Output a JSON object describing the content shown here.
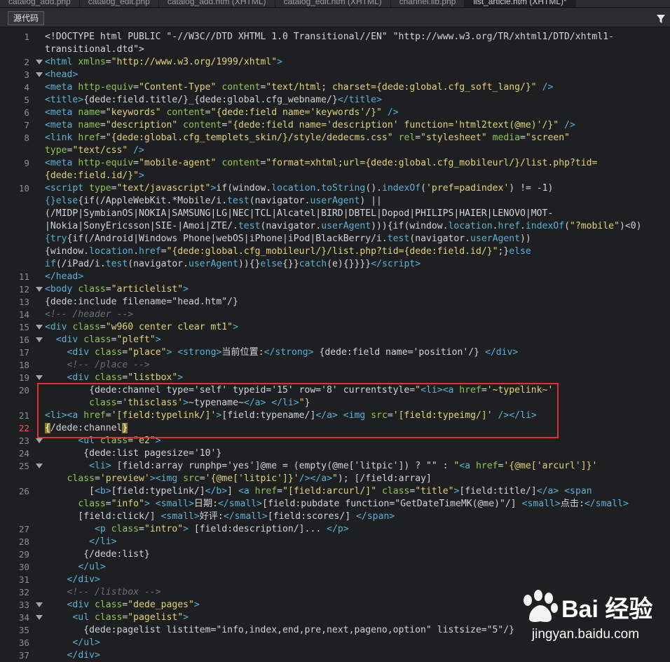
{
  "tabs": [
    {
      "label": "catalog_add.php"
    },
    {
      "label": "catalog_edit.php"
    },
    {
      "label": "catalog_add.htm (XHTML)"
    },
    {
      "label": "catalog_edit.htm (XHTML)"
    },
    {
      "label": "channel.lib.php"
    },
    {
      "label": "list_article.htm (XHTML)*"
    }
  ],
  "toolbar": {
    "source_label": "源代码",
    "filter_icon": "funnel-icon"
  },
  "watermark": {
    "logo_text": "Bai 经验",
    "url": "jingyan.baidu.com"
  },
  "colors": {
    "highlight_border": "#e0312e",
    "current_line": "#ff5050"
  },
  "lines": [
    {
      "num": "1",
      "fold": false,
      "html": "&lt;!DOCTYPE html PUBLIC &quot;-//W3C//DTD XHTML 1.0 Transitional//EN&quot; &quot;http://www.w3.org/TR/xhtml1/DTD/xhtml1-"
    },
    {
      "num": "",
      "fold": false,
      "html": "transitional.dtd&quot;&gt;"
    },
    {
      "num": "2",
      "fold": true,
      "html": "<span class=t>&lt;html</span> <span class=a>xmlns</span>=<span class=s>&quot;http://www.w3.org/1999/xhtml&quot;</span><span class=t>&gt;</span>"
    },
    {
      "num": "3",
      "fold": true,
      "html": "<span class=t>&lt;head&gt;</span>"
    },
    {
      "num": "4",
      "fold": false,
      "html": "<span class=t>&lt;meta</span> <span class=a>http-equiv</span>=<span class=s>&quot;Content-Type&quot;</span> <span class=a>content</span>=<span class=s>&quot;text/html; charset={dede:global.cfg_soft_lang/}&quot;</span> <span class=t>/&gt;</span>"
    },
    {
      "num": "5",
      "fold": false,
      "html": "<span class=t>&lt;title&gt;</span>{dede:field.title/}_{dede:global.cfg_webname/}<span class=t>&lt;/title&gt;</span>"
    },
    {
      "num": "6",
      "fold": false,
      "html": "<span class=t>&lt;meta</span> <span class=a>name</span>=<span class=s>&quot;keywords&quot;</span> <span class=a>content</span>=<span class=s>&quot;{dede:field name='keywords'/}&quot;</span> <span class=t>/&gt;</span>"
    },
    {
      "num": "7",
      "fold": false,
      "html": "<span class=t>&lt;meta</span> <span class=a>name</span>=<span class=s>&quot;description&quot;</span> <span class=a>content</span>=<span class=s>&quot;{dede:field name='description' function='html2text(@me)'/}&quot;</span> <span class=t>/&gt;</span>"
    },
    {
      "num": "8",
      "fold": false,
      "html": "<span class=t>&lt;link</span> <span class=a>href</span>=<span class=s>&quot;{dede:global.cfg_templets_skin/}/style/dedecms.css&quot;</span> <span class=a>rel</span>=<span class=s>&quot;stylesheet&quot;</span> <span class=a>media</span>=<span class=s>&quot;screen&quot;</span>"
    },
    {
      "num": "",
      "fold": false,
      "html": "<span class=a>type</span>=<span class=s>&quot;text/css&quot;</span> <span class=t>/&gt;</span>"
    },
    {
      "num": "9",
      "fold": false,
      "html": "<span class=t>&lt;meta</span> <span class=a>http-equiv</span>=<span class=s>&quot;mobile-agent&quot;</span> <span class=a>content</span>=<span class=s>&quot;format=xhtml;url={dede:global.cfg_mobileurl/}/list.php?tid=</span>"
    },
    {
      "num": "",
      "fold": false,
      "html": "<span class=s>{dede:field.id/}&quot;</span><span class=t>&gt;</span>"
    },
    {
      "num": "10",
      "fold": false,
      "html": "<span class=t>&lt;script</span> <span class=a>type</span>=<span class=s>&quot;text/javascript&quot;</span><span class=t>&gt;</span>if(window.<span class=kw>location</span>.<span class=kw>toString</span>().<span class=kw>indexOf</span>(<span class=s>'pref=padindex'</span>) != -1)"
    },
    {
      "num": "",
      "fold": false,
      "html": "<span class=kw>{}else</span>{if(/AppleWebKit.*Mobile/i.<span class=kw>test</span>(navigator.<span class=kw>userAgent</span>) ||"
    },
    {
      "num": "",
      "fold": false,
      "html": "(/MIDP|SymbianOS|NOKIA|SAMSUNG|LG|NEC|TCL|Alcatel|BIRD|DBTEL|Dopod|PHILIPS|HAIER|LENOVO|MOT-"
    },
    {
      "num": "",
      "fold": false,
      "html": "|Nokia|SonyEricsson|SIE-|Amoi|ZTE/.<span class=kw>test</span>(navigator.<span class=kw>userAgent</span>))){if(window.<span class=kw>location</span>.<span class=kw>href</span>.<span class=kw>indexOf</span>(<span class=s>&quot;?mobile&quot;</span>)&lt;0)"
    },
    {
      "num": "",
      "fold": false,
      "html": "<span class=kw>{try</span>{if(/Android|Windows Phone|webOS|iPhone|iPod|BlackBerry/i.<span class=kw>test</span>(navigator.<span class=kw>userAgent</span>))"
    },
    {
      "num": "",
      "fold": false,
      "html": "{window.<span class=kw>location</span>.<span class=kw>href</span>=<span class=s>&quot;{dede:global.cfg_mobileurl/}/list.php?tid={dede:field.id/}&quot;</span>;}<span class=kw>else</span>"
    },
    {
      "num": "",
      "fold": false,
      "html": "<span class=kw>if</span>(/iPad/i.<span class=kw>test</span>(navigator.<span class=kw>userAgent</span>)){}<span class=kw>else</span>{}}<span class=kw>catch</span>(e){}}}}<span class=t>&lt;/script&gt;</span>"
    },
    {
      "num": "11",
      "fold": false,
      "html": "<span class=t>&lt;/head&gt;</span>"
    },
    {
      "num": "12",
      "fold": true,
      "html": "<span class=t>&lt;body</span> <span class=a>class</span>=<span class=s>&quot;articlelist&quot;</span><span class=t>&gt;</span>"
    },
    {
      "num": "13",
      "fold": false,
      "html": "{dede:include filename=&quot;head.htm&quot;/}"
    },
    {
      "num": "14",
      "fold": false,
      "html": "<span class=cm>&lt;!-- /header --&gt;</span>"
    },
    {
      "num": "15",
      "fold": true,
      "html": "<span class=t>&lt;div</span> <span class=a>class</span>=<span class=s>&quot;w960 center clear mt1&quot;</span><span class=t>&gt;</span>"
    },
    {
      "num": "16",
      "fold": true,
      "html": "  <span class=t>&lt;div</span> <span class=a>class</span>=<span class=s>&quot;pleft&quot;</span><span class=t>&gt;</span>"
    },
    {
      "num": "17",
      "fold": false,
      "html": "    <span class=t>&lt;div</span> <span class=a>class</span>=<span class=s>&quot;place&quot;</span><span class=t>&gt;</span> <span class=t>&lt;strong&gt;</span>当前位置:<span class=t>&lt;/strong&gt;</span> {dede:field name='position'/} <span class=t>&lt;/div&gt;</span>"
    },
    {
      "num": "18",
      "fold": false,
      "html": "    <span class=cm>&lt;!-- /place --&gt;</span>"
    },
    {
      "num": "19",
      "fold": true,
      "html": "    <span class=t>&lt;div</span> <span class=a>class</span>=<span class=s>&quot;listbox&quot;</span><span class=t>&gt;</span>"
    },
    {
      "num": "20",
      "fold": false,
      "html": "        {dede:channel type='self' typeid='15' row='8' currentstyle=<span class=s>&quot;</span><span class=t>&lt;li&gt;&lt;a</span> <span class=a>href</span>=<span class=s>'~typelink~'</span>"
    },
    {
      "num": "",
      "fold": false,
      "html": "        <span class=a>class</span>=<span class=s>'thisclass'</span><span class=t>&gt;</span>~typename~<span class=t>&lt;/a&gt;</span> <span class=t>&lt;/li&gt;</span><span class=s>&quot;</span>}"
    },
    {
      "num": "21",
      "fold": false,
      "html": "<span class=t>&lt;li&gt;&lt;a</span> <span class=a>href</span>=<span class=s>'[field:typelink/]'</span><span class=t>&gt;</span>[field:typename/]<span class=t>&lt;/a&gt;</span> <span class=t>&lt;img</span> <span class=a>src</span>=<span class=s>'[field:typeimg/]'</span> <span class=t>/&gt;&lt;/li&gt;</span>"
    },
    {
      "num": "22",
      "fold": false,
      "html": "<span class=ch>{</span>/dede:channel<span class=ch>}</span>"
    },
    {
      "num": "23",
      "fold": true,
      "html": "      <span class=t>&lt;ul</span> <span class=a>class</span>=<span class=s>&quot;e2&quot;</span><span class=t>&gt;</span>"
    },
    {
      "num": "24",
      "fold": false,
      "html": "       {dede:list pagesize='10'}"
    },
    {
      "num": "25",
      "fold": true,
      "html": "        <span class=t>&lt;li&gt;</span> [field:array runphp='yes']@me = (empty(@me['litpic']) ? &quot;&quot; : <span class=s>&quot;</span><span class=t>&lt;a</span> <span class=a>href</span>=<span class=s>'{@me['arcurl']}'</span>"
    },
    {
      "num": "",
      "fold": false,
      "html": "    <span class=a>class</span>=<span class=s>'preview'</span><span class=t>&gt;&lt;img</span> <span class=a>src</span>=<span class=s>'{@me['litpic']}'</span><span class=t>/&gt;&lt;/a&gt;</span><span class=s>&quot;</span>); [/field:array]"
    },
    {
      "num": "26",
      "fold": false,
      "html": "        [<span class=t>&lt;b&gt;</span>[field:typelink/]<span class=t>&lt;/b&gt;</span>] <span class=t>&lt;a</span> <span class=a>href</span>=<span class=s>&quot;[field:arcurl/]&quot;</span> <span class=a>class</span>=<span class=s>&quot;title&quot;</span><span class=t>&gt;</span>[field:title/]<span class=t>&lt;/a&gt;</span> <span class=t>&lt;span</span>"
    },
    {
      "num": "",
      "fold": false,
      "html": "      <span class=a>class</span>=<span class=s>&quot;info&quot;</span><span class=t>&gt;</span> <span class=t>&lt;small&gt;</span>日期:<span class=t>&lt;/small&gt;</span>[field:pubdate function=&quot;GetDateTimeMK(@me)&quot;/] <span class=t>&lt;small&gt;</span>点击:<span class=t>&lt;/small&gt;</span>"
    },
    {
      "num": "",
      "fold": false,
      "html": "      [field:click/] <span class=t>&lt;small&gt;</span>好评:<span class=t>&lt;/small&gt;</span>[field:scores/] <span class=t>&lt;/span&gt;</span>"
    },
    {
      "num": "27",
      "fold": false,
      "html": "         <span class=t>&lt;p</span> <span class=a>class</span>=<span class=s>&quot;intro&quot;</span><span class=t>&gt;</span> [field:description/]... <span class=t>&lt;/p&gt;</span>"
    },
    {
      "num": "28",
      "fold": false,
      "html": "        <span class=t>&lt;/li&gt;</span>"
    },
    {
      "num": "29",
      "fold": false,
      "html": "       {/dede:list}"
    },
    {
      "num": "30",
      "fold": false,
      "html": "      <span class=t>&lt;/ul&gt;</span>"
    },
    {
      "num": "31",
      "fold": false,
      "html": "    <span class=t>&lt;/div&gt;</span>"
    },
    {
      "num": "32",
      "fold": false,
      "html": "    <span class=cm>&lt;!-- /listbox --&gt;</span>"
    },
    {
      "num": "33",
      "fold": true,
      "html": "    <span class=t>&lt;div</span> <span class=a>class</span>=<span class=s>&quot;dede_pages&quot;</span><span class=t>&gt;</span>"
    },
    {
      "num": "34",
      "fold": true,
      "html": "     <span class=t>&lt;ul</span> <span class=a>class</span>=<span class=s>&quot;pagelist&quot;</span><span class=t>&gt;</span>"
    },
    {
      "num": "35",
      "fold": false,
      "html": "       {dede:pagelist listitem=&quot;info,index,end,pre,next,pageno,option&quot; listsize=&quot;5&quot;/}"
    },
    {
      "num": "36",
      "fold": false,
      "html": "     <span class=t>&lt;/ul&gt;</span>"
    },
    {
      "num": "37",
      "fold": false,
      "html": "    <span class=t>&lt;/div&gt;</span>"
    }
  ]
}
